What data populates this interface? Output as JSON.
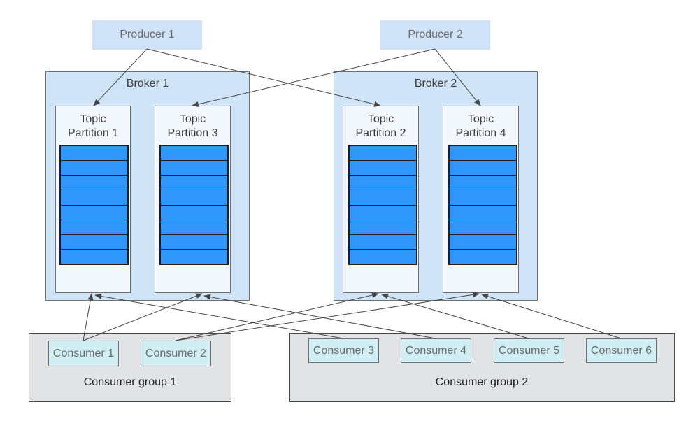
{
  "producers": [
    {
      "id": "producer-1",
      "label": "Producer 1"
    },
    {
      "id": "producer-2",
      "label": "Producer 2"
    }
  ],
  "brokers": [
    {
      "id": "broker-1",
      "label": "Broker 1",
      "partitions": [
        {
          "id": "partition-1",
          "line1": "Topic",
          "line2": "Partition 1",
          "segments": 8
        },
        {
          "id": "partition-3",
          "line1": "Topic",
          "line2": "Partition 3",
          "segments": 8
        }
      ]
    },
    {
      "id": "broker-2",
      "label": "Broker 2",
      "partitions": [
        {
          "id": "partition-2",
          "line1": "Topic",
          "line2": "Partition 2",
          "segments": 8
        },
        {
          "id": "partition-4",
          "line1": "Topic",
          "line2": "Partition 4",
          "segments": 8
        }
      ]
    }
  ],
  "consumer_groups": [
    {
      "id": "consumer-group-1",
      "label": "Consumer group 1",
      "consumers": [
        "Consumer 1",
        "Consumer 2"
      ]
    },
    {
      "id": "consumer-group-2",
      "label": "Consumer group 2",
      "consumers": [
        "Consumer 3",
        "Consumer 4",
        "Consumer 5",
        "Consumer 6"
      ]
    }
  ],
  "edges": [
    {
      "from": "producer-1",
      "to": "partition-1"
    },
    {
      "from": "producer-1",
      "to": "partition-2"
    },
    {
      "from": "producer-2",
      "to": "partition-3"
    },
    {
      "from": "producer-2",
      "to": "partition-4"
    },
    {
      "from": "consumer-1",
      "to": "partition-1"
    },
    {
      "from": "consumer-1",
      "to": "partition-3"
    },
    {
      "from": "consumer-2",
      "to": "partition-2"
    },
    {
      "from": "consumer-2",
      "to": "partition-4"
    },
    {
      "from": "consumer-3",
      "to": "partition-1"
    },
    {
      "from": "consumer-4",
      "to": "partition-3"
    },
    {
      "from": "consumer-5",
      "to": "partition-2"
    },
    {
      "from": "consumer-6",
      "to": "partition-4"
    }
  ],
  "colors": {
    "producer_fill": "#cfe2f7",
    "broker_fill": "#d0e4f8",
    "partition_fill": "#f3f7fe",
    "log_fill": "#3096fb",
    "consumer_fill": "#d1eef4",
    "group_fill": "#e1e3e4",
    "edge": "#444444"
  }
}
